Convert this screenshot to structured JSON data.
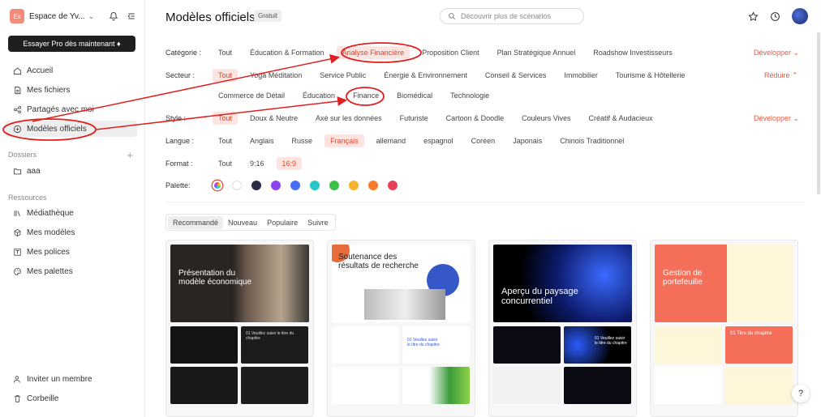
{
  "workspace": {
    "initials": "Ex",
    "name": "Espace de Yv..."
  },
  "sidebar": {
    "pro_button": "Essayer Pro dès maintenant ♦",
    "nav": [
      "Accueil",
      "Mes fichiers",
      "Partagés avec moi",
      "Modèles officiels"
    ],
    "folders_heading": "Dossiers",
    "folders": [
      "aaa"
    ],
    "resources_heading": "Ressources",
    "resources": [
      "Médiathèque",
      "Mes modèles",
      "Mes polices",
      "Mes palettes"
    ],
    "bottom": [
      "Inviter un membre",
      "Corbeille"
    ]
  },
  "header": {
    "title": "Modèles officiels",
    "badge": "Gratuit",
    "search_placeholder": "Découvrir plus de scénarios"
  },
  "filters": {
    "category": {
      "label": "Catégorie :",
      "options": [
        "Tout",
        "Éducation & Formation",
        "Analyse Financière",
        "Proposition Client",
        "Plan Stratégique Annuel",
        "Roadshow Investisseurs"
      ],
      "active": "Analyse Financière",
      "toggle": "Développer"
    },
    "sector": {
      "label": "Secteur :",
      "options_row1": [
        "Tout",
        "Yoga Méditation",
        "Service Public",
        "Énergie & Environnement",
        "Conseil & Services",
        "Immobilier",
        "Tourisme & Hôtellerie"
      ],
      "options_row2": [
        "Commerce de Détail",
        "Éducation",
        "Finance",
        "Biomédical",
        "Technologie"
      ],
      "active": "Tout",
      "toggle": "Réduire"
    },
    "style": {
      "label": "Style :",
      "options": [
        "Tout",
        "Doux & Neutre",
        "Axé sur les données",
        "Futuriste",
        "Cartoon & Doodle",
        "Couleurs Vives",
        "Créatif & Audacieux"
      ],
      "active": "Tout",
      "toggle": "Développer"
    },
    "language": {
      "label": "Langue :",
      "options": [
        "Tout",
        "Anglais",
        "Russe",
        "Français",
        "allemand",
        "espagnol",
        "Coréen",
        "Japonais",
        "Chinois Traditionnel"
      ],
      "active": "Français"
    },
    "format": {
      "label": "Format :",
      "options": [
        "Tout",
        "9:16",
        "16:9"
      ],
      "active": "16:9"
    },
    "palette": {
      "label": "Palette:",
      "colors": [
        "#ffffff",
        "#2b2d42",
        "#8e44ec",
        "#4a6cf7",
        "#26c6c6",
        "#3fbf4a",
        "#f7b32b",
        "#f77b2b",
        "#e8405a"
      ]
    }
  },
  "sort_tabs": [
    "Recommandé",
    "Nouveau",
    "Populaire",
    "Suivre"
  ],
  "cards": [
    {
      "title": "Présentation du modèle économique",
      "caption": "01 Veuillez saisir le titre du chapitre"
    },
    {
      "title": "Soutenance des résultats de recherche",
      "caption": "01 Veuillez saisir le titre du chapitre"
    },
    {
      "title": "Aperçu du paysage concurrentiel",
      "caption": "01 Veuillez saisir le titre du chapitre"
    },
    {
      "title": "Gestion de portefeuille",
      "caption": "01 Titre du chapitre"
    }
  ],
  "help": "?"
}
